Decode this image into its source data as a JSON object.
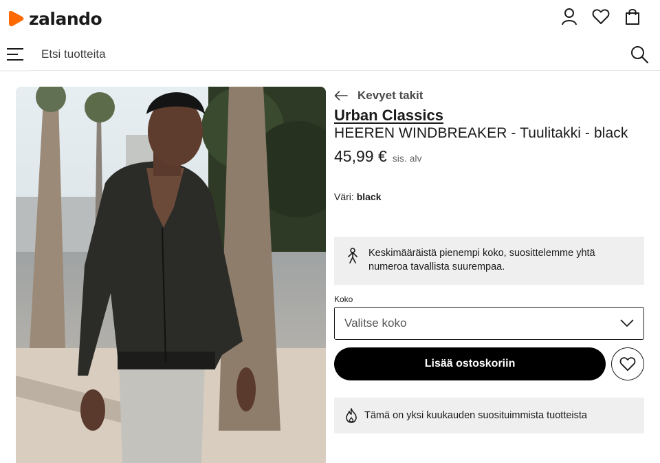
{
  "header": {
    "logo_text": "zalando",
    "brand_color": "#ff6900",
    "icons": [
      "user-icon",
      "heart-icon",
      "bag-icon"
    ]
  },
  "search": {
    "placeholder": "Etsi tuotteita",
    "icons": [
      "menu-icon",
      "search-icon"
    ]
  },
  "product": {
    "category_back": "Kevyet takit",
    "brand": "Urban Classics",
    "name": "HEEREN WINDBREAKER - Tuulitakki - black",
    "price": "45,99 €",
    "vat_note": "sis. alv",
    "color_label": "Väri:",
    "color_value": "black",
    "size_note": "Keskimääräistä pienempi koko, suosittelemme yhtä numeroa tavallista suurempaa.",
    "size_label": "Koko",
    "size_placeholder": "Valitse koko",
    "add_to_cart": "Lisää ostoskoriin",
    "popular_note": "Tämä on yksi kuukauden suosituimmista tuotteista"
  }
}
